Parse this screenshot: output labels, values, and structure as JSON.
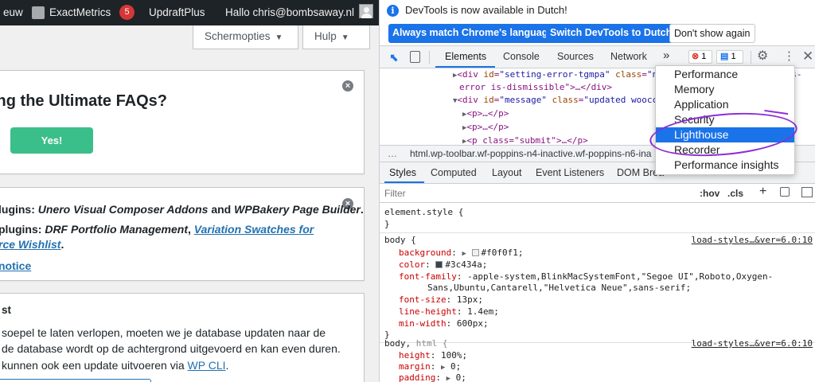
{
  "wp": {
    "adminbar": {
      "left_fragment": "euw",
      "exactmetrics_label": "ExactMetrics",
      "exactmetrics_count": "5",
      "updraft_label": "UpdraftPlus",
      "greeting": "Hallo chris@bombsaway.nl"
    },
    "screen_options_label": "Schermopties",
    "help_label": "Hulp",
    "faq_notice": {
      "title": "ing the Ultimate FAQs?",
      "yes_label": "Yes!"
    },
    "plugins_notice": {
      "line1_prefix": "lugins: ",
      "line1_a": "Unero Visual Composer Addons",
      "line1_and": " and ",
      "line1_b": "WPBakery Page Builder",
      "line1_end": ".",
      "line2_prefix": " plugins: ",
      "line2_a": "DRF Portfolio Management",
      "line2_sep": ", ",
      "line2_link": "Variation Swatches for",
      "line3_link": "rce Wishlist",
      "line3_end": ".",
      "line4_link": "notice"
    },
    "db_notice": {
      "title": "st",
      "line1": "soepel te laten verlopen, moeten we je database updaten naar de",
      "line2": "de database wordt op de achtergrond uitgevoerd en kan even duren.",
      "line3_prefix": "kunnen ook een update uitvoeren via ",
      "line3_link": "WP CLI",
      "line3_end": "."
    }
  },
  "devtools": {
    "infobar": {
      "message": "DevTools is now available in Dutch!",
      "btn_match": "Always match Chrome's language",
      "btn_switch": "Switch DevTools to Dutch",
      "btn_dismiss": "Don't show again"
    },
    "tabs": [
      "Elements",
      "Console",
      "Sources",
      "Network"
    ],
    "more_tabs": "»",
    "error_count": "1",
    "message_count": "1",
    "dom_lines": [
      {
        "tag_open": "<div ",
        "attr1": "id",
        "val1": "\"setting-error-tgmpa\"",
        "attr2": " class",
        "val2": "\"n"
      },
      {
        "text": "error is-dismissible\">…</div>"
      },
      {
        "tag_open": "<div ",
        "attr1": "id",
        "val1": "\"message\"",
        "attr2": " class",
        "val2": "\"updated woocc"
      },
      {
        "text": "<p>…</p>"
      },
      {
        "text": "<p>…</p>"
      },
      {
        "text": "<p class=\"submit\">…</p>"
      }
    ],
    "dom_right_fragment": "ngs-",
    "breadcrumb": "html.wp-toolbar.wf-poppins-n4-inactive.wf-poppins-n6-ina",
    "subtabs": [
      "Styles",
      "Computed",
      "Layout",
      "Event Listeners",
      "DOM Brea"
    ],
    "filter_placeholder": "Filter",
    "hov_label": ":hov",
    "cls_label": ".cls",
    "plus_label": "+",
    "styles": {
      "element_style": "element.style {",
      "close_brace": "}",
      "body_selector": "body {",
      "body_source": "load-styles…&ver=6.0:10",
      "body_props": [
        {
          "name": "background",
          "value": "#f0f0f1;",
          "swatch": "#f0f0f1",
          "expand": true
        },
        {
          "name": "color",
          "value": "#3c434a;",
          "swatch": "#3c434a",
          "expand": false
        },
        {
          "name": "font-family",
          "value": "-apple-system,BlinkMacSystemFont,\"Segoe UI\",Roboto,Oxygen-",
          "swatch": "",
          "expand": false
        },
        {
          "name": "",
          "value": "Sans,Ubuntu,Cantarell,\"Helvetica Neue\",sans-serif;",
          "swatch": "",
          "expand": false
        },
        {
          "name": "font-size",
          "value": "13px;",
          "swatch": "",
          "expand": false
        },
        {
          "name": "line-height",
          "value": "1.4em;",
          "swatch": "",
          "expand": false
        },
        {
          "name": "min-width",
          "value": "600px;",
          "swatch": "",
          "expand": false
        }
      ],
      "html_selector_a": "body, ",
      "html_selector_b": "html {",
      "html_source": "load-styles…&ver=6.0:10",
      "html_props": [
        {
          "name": "height",
          "value": "100%;",
          "expand": false
        },
        {
          "name": "margin",
          "value": "0;",
          "expand": true
        },
        {
          "name": "padding",
          "value": "0;",
          "expand": true
        }
      ]
    },
    "overflow_menu": {
      "items": [
        "Performance",
        "Memory",
        "Application",
        "Security",
        "Lighthouse",
        "Recorder",
        "Performance insights"
      ],
      "highlighted": "Lighthouse"
    },
    "colors": {
      "accent": "#1a73e8",
      "annotation": "#8c2dd6",
      "wp_green": "#3bbf8a"
    }
  }
}
